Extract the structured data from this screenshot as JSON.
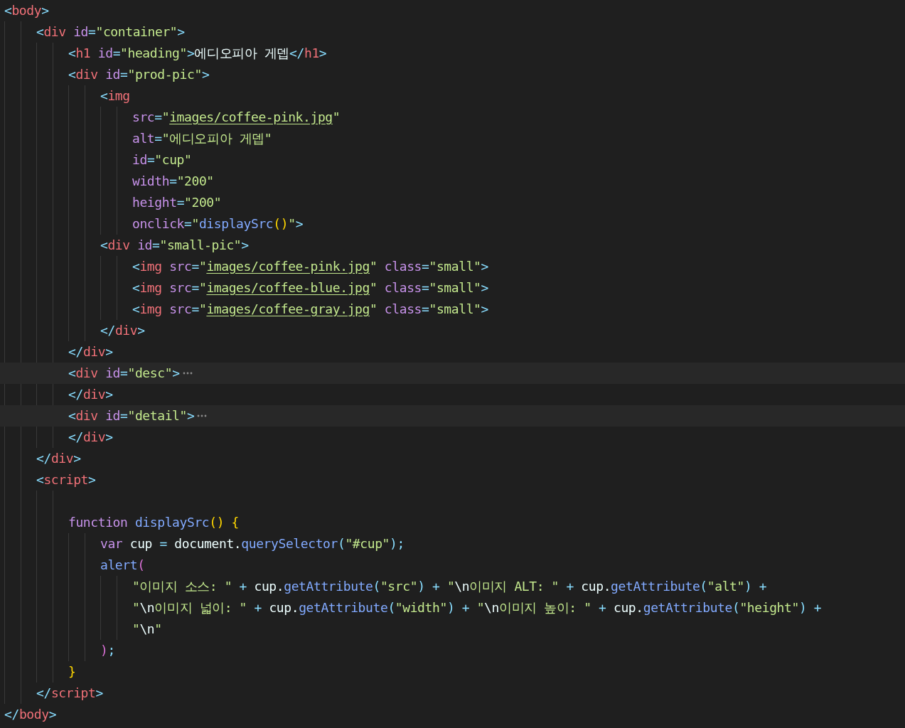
{
  "editor": {
    "lines": [
      {
        "kind": "code",
        "tokens": [
          {
            "kind": "punct",
            "text": "<"
          },
          {
            "kind": "tag",
            "text": "body"
          },
          {
            "kind": "punct",
            "text": ">"
          }
        ],
        "children": [
          {
            "kind": "code",
            "tokens": [
              {
                "kind": "punct",
                "text": "<"
              },
              {
                "kind": "tag",
                "text": "div"
              },
              {
                "kind": "attr",
                "text": " id"
              },
              {
                "kind": "punct",
                "text": "="
              },
              {
                "kind": "string",
                "text": "\"container\""
              },
              {
                "kind": "punct",
                "text": ">"
              }
            ],
            "children": [
              {
                "kind": "code",
                "tokens": [
                  {
                    "kind": "punct",
                    "text": "<"
                  },
                  {
                    "kind": "tag",
                    "text": "h1"
                  },
                  {
                    "kind": "attr",
                    "text": " id"
                  },
                  {
                    "kind": "punct",
                    "text": "="
                  },
                  {
                    "kind": "string",
                    "text": "\"heading\""
                  },
                  {
                    "kind": "punct",
                    "text": ">"
                  },
                  {
                    "kind": "plain",
                    "text": "에디오피아 게뎁"
                  },
                  {
                    "kind": "punct",
                    "text": "</"
                  },
                  {
                    "kind": "tag",
                    "text": "h1"
                  },
                  {
                    "kind": "punct",
                    "text": ">"
                  }
                ]
              },
              {
                "kind": "code",
                "tokens": [
                  {
                    "kind": "punct",
                    "text": "<"
                  },
                  {
                    "kind": "tag",
                    "text": "div"
                  },
                  {
                    "kind": "attr",
                    "text": " id"
                  },
                  {
                    "kind": "punct",
                    "text": "="
                  },
                  {
                    "kind": "string",
                    "text": "\"prod-pic\""
                  },
                  {
                    "kind": "punct",
                    "text": ">"
                  }
                ],
                "children": [
                  {
                    "kind": "code",
                    "tokens": [
                      {
                        "kind": "punct",
                        "text": "<"
                      },
                      {
                        "kind": "tag",
                        "text": "img"
                      }
                    ],
                    "children": [
                      {
                        "kind": "code",
                        "tokens": [
                          {
                            "kind": "attr",
                            "text": "src"
                          },
                          {
                            "kind": "punct",
                            "text": "="
                          },
                          {
                            "kind": "string",
                            "text": "\""
                          },
                          {
                            "kind": "link",
                            "text": "images/coffee-pink.jpg"
                          },
                          {
                            "kind": "string",
                            "text": "\""
                          }
                        ]
                      },
                      {
                        "kind": "code",
                        "tokens": [
                          {
                            "kind": "attr",
                            "text": "alt"
                          },
                          {
                            "kind": "punct",
                            "text": "="
                          },
                          {
                            "kind": "string",
                            "text": "\"에디오피아 게뎁\""
                          }
                        ]
                      },
                      {
                        "kind": "code",
                        "tokens": [
                          {
                            "kind": "attr",
                            "text": "id"
                          },
                          {
                            "kind": "punct",
                            "text": "="
                          },
                          {
                            "kind": "string",
                            "text": "\"cup\""
                          }
                        ]
                      },
                      {
                        "kind": "code",
                        "tokens": [
                          {
                            "kind": "attr",
                            "text": "width"
                          },
                          {
                            "kind": "punct",
                            "text": "="
                          },
                          {
                            "kind": "string",
                            "text": "\"200\""
                          }
                        ]
                      },
                      {
                        "kind": "code",
                        "tokens": [
                          {
                            "kind": "attr",
                            "text": "height"
                          },
                          {
                            "kind": "punct",
                            "text": "="
                          },
                          {
                            "kind": "string",
                            "text": "\"200\""
                          }
                        ]
                      },
                      {
                        "kind": "code",
                        "tokens": [
                          {
                            "kind": "attr",
                            "text": "onclick"
                          },
                          {
                            "kind": "punct",
                            "text": "="
                          },
                          {
                            "kind": "string",
                            "text": "\""
                          },
                          {
                            "kind": "func",
                            "text": "displaySrc"
                          },
                          {
                            "kind": "paren1",
                            "text": "()"
                          },
                          {
                            "kind": "string",
                            "text": "\""
                          },
                          {
                            "kind": "punct",
                            "text": ">"
                          }
                        ]
                      }
                    ]
                  },
                  {
                    "kind": "code",
                    "tokens": [
                      {
                        "kind": "punct",
                        "text": "<"
                      },
                      {
                        "kind": "tag",
                        "text": "div"
                      },
                      {
                        "kind": "attr",
                        "text": " id"
                      },
                      {
                        "kind": "punct",
                        "text": "="
                      },
                      {
                        "kind": "string",
                        "text": "\"small-pic\""
                      },
                      {
                        "kind": "punct",
                        "text": ">"
                      }
                    ],
                    "children": [
                      {
                        "kind": "code",
                        "tokens": [
                          {
                            "kind": "punct",
                            "text": "<"
                          },
                          {
                            "kind": "tag",
                            "text": "img"
                          },
                          {
                            "kind": "attr",
                            "text": " src"
                          },
                          {
                            "kind": "punct",
                            "text": "="
                          },
                          {
                            "kind": "string",
                            "text": "\""
                          },
                          {
                            "kind": "link",
                            "text": "images/coffee-pink.jpg"
                          },
                          {
                            "kind": "string",
                            "text": "\""
                          },
                          {
                            "kind": "attr",
                            "text": " class"
                          },
                          {
                            "kind": "punct",
                            "text": "="
                          },
                          {
                            "kind": "string",
                            "text": "\"small\""
                          },
                          {
                            "kind": "punct",
                            "text": ">"
                          }
                        ]
                      },
                      {
                        "kind": "code",
                        "tokens": [
                          {
                            "kind": "punct",
                            "text": "<"
                          },
                          {
                            "kind": "tag",
                            "text": "img"
                          },
                          {
                            "kind": "attr",
                            "text": " src"
                          },
                          {
                            "kind": "punct",
                            "text": "="
                          },
                          {
                            "kind": "string",
                            "text": "\""
                          },
                          {
                            "kind": "link",
                            "text": "images/coffee-blue.jpg"
                          },
                          {
                            "kind": "string",
                            "text": "\""
                          },
                          {
                            "kind": "attr",
                            "text": " class"
                          },
                          {
                            "kind": "punct",
                            "text": "="
                          },
                          {
                            "kind": "string",
                            "text": "\"small\""
                          },
                          {
                            "kind": "punct",
                            "text": ">"
                          }
                        ]
                      },
                      {
                        "kind": "code",
                        "tokens": [
                          {
                            "kind": "punct",
                            "text": "<"
                          },
                          {
                            "kind": "tag",
                            "text": "img"
                          },
                          {
                            "kind": "attr",
                            "text": " src"
                          },
                          {
                            "kind": "punct",
                            "text": "="
                          },
                          {
                            "kind": "string",
                            "text": "\""
                          },
                          {
                            "kind": "link",
                            "text": "images/coffee-gray.jpg"
                          },
                          {
                            "kind": "string",
                            "text": "\""
                          },
                          {
                            "kind": "attr",
                            "text": " class"
                          },
                          {
                            "kind": "punct",
                            "text": "="
                          },
                          {
                            "kind": "string",
                            "text": "\"small\""
                          },
                          {
                            "kind": "punct",
                            "text": ">"
                          }
                        ]
                      }
                    ]
                  },
                  {
                    "kind": "code",
                    "tokens": [
                      {
                        "kind": "punct",
                        "text": "</"
                      },
                      {
                        "kind": "tag",
                        "text": "div"
                      },
                      {
                        "kind": "punct",
                        "text": ">"
                      }
                    ]
                  }
                ]
              },
              {
                "kind": "code",
                "tokens": [
                  {
                    "kind": "punct",
                    "text": "</"
                  },
                  {
                    "kind": "tag",
                    "text": "div"
                  },
                  {
                    "kind": "punct",
                    "text": ">"
                  }
                ]
              },
              {
                "kind": "code",
                "folded": true,
                "tokens": [
                  {
                    "kind": "punct",
                    "text": "<"
                  },
                  {
                    "kind": "tag",
                    "text": "div"
                  },
                  {
                    "kind": "attr",
                    "text": " id"
                  },
                  {
                    "kind": "punct",
                    "text": "="
                  },
                  {
                    "kind": "string",
                    "text": "\"desc\""
                  },
                  {
                    "kind": "punct",
                    "text": ">"
                  }
                ]
              },
              {
                "kind": "code",
                "tokens": [
                  {
                    "kind": "punct",
                    "text": "</"
                  },
                  {
                    "kind": "tag",
                    "text": "div"
                  },
                  {
                    "kind": "punct",
                    "text": ">"
                  }
                ]
              },
              {
                "kind": "code",
                "folded": true,
                "tokens": [
                  {
                    "kind": "punct",
                    "text": "<"
                  },
                  {
                    "kind": "tag",
                    "text": "div"
                  },
                  {
                    "kind": "attr",
                    "text": " id"
                  },
                  {
                    "kind": "punct",
                    "text": "="
                  },
                  {
                    "kind": "string",
                    "text": "\"detail\""
                  },
                  {
                    "kind": "punct",
                    "text": ">"
                  }
                ]
              },
              {
                "kind": "code",
                "tokens": [
                  {
                    "kind": "punct",
                    "text": "</"
                  },
                  {
                    "kind": "tag",
                    "text": "div"
                  },
                  {
                    "kind": "punct",
                    "text": ">"
                  }
                ]
              }
            ]
          },
          {
            "kind": "code",
            "tokens": [
              {
                "kind": "punct",
                "text": "</"
              },
              {
                "kind": "tag",
                "text": "div"
              },
              {
                "kind": "punct",
                "text": ">"
              }
            ]
          },
          {
            "kind": "code",
            "tokens": [
              {
                "kind": "punct",
                "text": "<"
              },
              {
                "kind": "tag",
                "text": "script"
              },
              {
                "kind": "punct",
                "text": ">"
              }
            ],
            "children": [
              {
                "kind": "blank"
              },
              {
                "kind": "code",
                "tokens": [
                  {
                    "kind": "keyword",
                    "text": "function"
                  },
                  {
                    "kind": "func",
                    "text": " displaySrc"
                  },
                  {
                    "kind": "paren1",
                    "text": "()"
                  },
                  {
                    "kind": "paren1",
                    "text": " {"
                  }
                ],
                "children": [
                  {
                    "kind": "code",
                    "tokens": [
                      {
                        "kind": "keyword",
                        "text": "var"
                      },
                      {
                        "kind": "plain",
                        "text": " cup "
                      },
                      {
                        "kind": "punct",
                        "text": "="
                      },
                      {
                        "kind": "plain",
                        "text": " document."
                      },
                      {
                        "kind": "func",
                        "text": "querySelector"
                      },
                      {
                        "kind": "punct",
                        "text": "("
                      },
                      {
                        "kind": "string",
                        "text": "\"#cup\""
                      },
                      {
                        "kind": "punct",
                        "text": ");"
                      }
                    ]
                  },
                  {
                    "kind": "code",
                    "tokens": [
                      {
                        "kind": "func",
                        "text": "alert"
                      },
                      {
                        "kind": "paren2",
                        "text": "("
                      }
                    ],
                    "children": [
                      {
                        "kind": "code",
                        "tokens": [
                          {
                            "kind": "string",
                            "text": "\"이미지 소스: \""
                          },
                          {
                            "kind": "punct",
                            "text": " + "
                          },
                          {
                            "kind": "plain",
                            "text": "cup."
                          },
                          {
                            "kind": "func",
                            "text": "getAttribute"
                          },
                          {
                            "kind": "punct",
                            "text": "("
                          },
                          {
                            "kind": "string",
                            "text": "\"src\""
                          },
                          {
                            "kind": "punct",
                            "text": ")"
                          },
                          {
                            "kind": "punct",
                            "text": " + "
                          },
                          {
                            "kind": "string",
                            "text": "\""
                          },
                          {
                            "kind": "plain",
                            "text": "\\n"
                          },
                          {
                            "kind": "string",
                            "text": "이미지 ALT: \""
                          },
                          {
                            "kind": "punct",
                            "text": " + "
                          },
                          {
                            "kind": "plain",
                            "text": "cup."
                          },
                          {
                            "kind": "func",
                            "text": "getAttribute"
                          },
                          {
                            "kind": "punct",
                            "text": "("
                          },
                          {
                            "kind": "string",
                            "text": "\"alt\""
                          },
                          {
                            "kind": "punct",
                            "text": ")"
                          },
                          {
                            "kind": "punct",
                            "text": " +"
                          }
                        ]
                      },
                      {
                        "kind": "code",
                        "tokens": [
                          {
                            "kind": "string",
                            "text": "\""
                          },
                          {
                            "kind": "plain",
                            "text": "\\n"
                          },
                          {
                            "kind": "string",
                            "text": "이미지 넓이: \""
                          },
                          {
                            "kind": "punct",
                            "text": " + "
                          },
                          {
                            "kind": "plain",
                            "text": "cup."
                          },
                          {
                            "kind": "func",
                            "text": "getAttribute"
                          },
                          {
                            "kind": "punct",
                            "text": "("
                          },
                          {
                            "kind": "string",
                            "text": "\"width\""
                          },
                          {
                            "kind": "punct",
                            "text": ")"
                          },
                          {
                            "kind": "punct",
                            "text": " + "
                          },
                          {
                            "kind": "string",
                            "text": "\""
                          },
                          {
                            "kind": "plain",
                            "text": "\\n"
                          },
                          {
                            "kind": "string",
                            "text": "이미지 높이: \""
                          },
                          {
                            "kind": "punct",
                            "text": " + "
                          },
                          {
                            "kind": "plain",
                            "text": "cup."
                          },
                          {
                            "kind": "func",
                            "text": "getAttribute"
                          },
                          {
                            "kind": "punct",
                            "text": "("
                          },
                          {
                            "kind": "string",
                            "text": "\"height\""
                          },
                          {
                            "kind": "punct",
                            "text": ")"
                          },
                          {
                            "kind": "punct",
                            "text": " +"
                          }
                        ]
                      },
                      {
                        "kind": "code",
                        "tokens": [
                          {
                            "kind": "string",
                            "text": "\""
                          },
                          {
                            "kind": "plain",
                            "text": "\\n"
                          },
                          {
                            "kind": "string",
                            "text": "\""
                          }
                        ]
                      }
                    ]
                  },
                  {
                    "kind": "code",
                    "tokens": [
                      {
                        "kind": "paren2",
                        "text": ")"
                      },
                      {
                        "kind": "punct",
                        "text": ";"
                      }
                    ]
                  }
                ]
              },
              {
                "kind": "code",
                "tokens": [
                  {
                    "kind": "paren1",
                    "text": "}"
                  }
                ]
              }
            ]
          },
          {
            "kind": "code",
            "tokens": [
              {
                "kind": "punct",
                "text": "</"
              },
              {
                "kind": "tag",
                "text": "script"
              },
              {
                "kind": "punct",
                "text": ">"
              }
            ]
          }
        ]
      },
      {
        "kind": "code",
        "tokens": [
          {
            "kind": "punct",
            "text": "</"
          },
          {
            "kind": "tag",
            "text": "body"
          },
          {
            "kind": "punct",
            "text": ">"
          }
        ]
      }
    ]
  }
}
